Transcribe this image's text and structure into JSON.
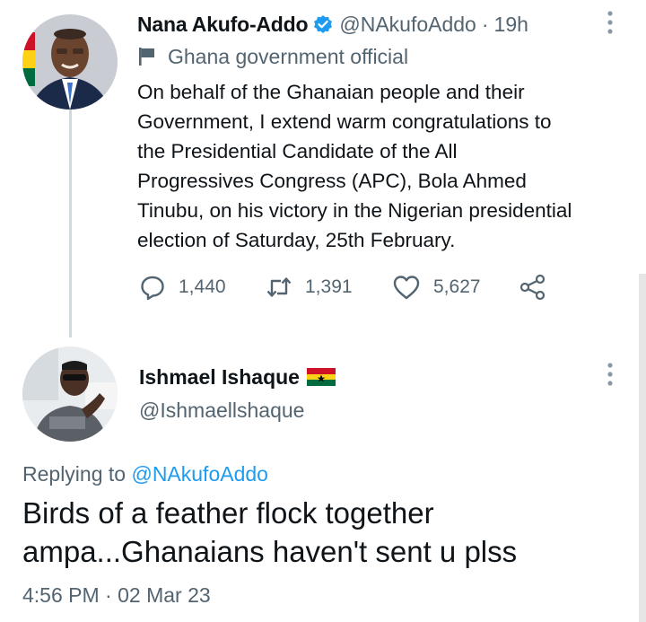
{
  "tweet": {
    "author_name": "Nana Akufo-Addo",
    "handle": "@NAkufoAddo",
    "separator": "·",
    "time": "19h",
    "label": "Ghana government official",
    "text": "On behalf of the Ghanaian people and their\nGovernment, I extend warm congratulations to\nthe Presidential Candidate of the All\nProgressives Congress (APC), Bola Ahmed\nTinubu, on his victory in the Nigerian presidential\nelection of Saturday, 25th February.",
    "stats": {
      "replies": "1,440",
      "retweets": "1,391",
      "likes": "5,627"
    },
    "icons": [
      "verified-icon",
      "government-flag-icon",
      "more-options-icon",
      "reply-icon",
      "retweet-icon",
      "like-icon",
      "share-icon"
    ]
  },
  "reply": {
    "author_name": "Ishmael Ishaque",
    "handle": "@Ishmaellshaque",
    "replying_prefix": "Replying to",
    "replying_to": "@NAkufoAddo",
    "text": "Birds of a feather flock together\nampa...Ghanaians haven't sent u plss",
    "time": "4:56 PM",
    "separator": "·",
    "date": "02 Mar 23",
    "icons": [
      "ghana-flag-emoji",
      "more-options-icon"
    ]
  },
  "colors": {
    "text_primary": "#0f1419",
    "text_secondary": "#536471",
    "accent": "#1d9bf0",
    "verified": "#1d9bf0",
    "thread_line": "#cfd9de"
  }
}
